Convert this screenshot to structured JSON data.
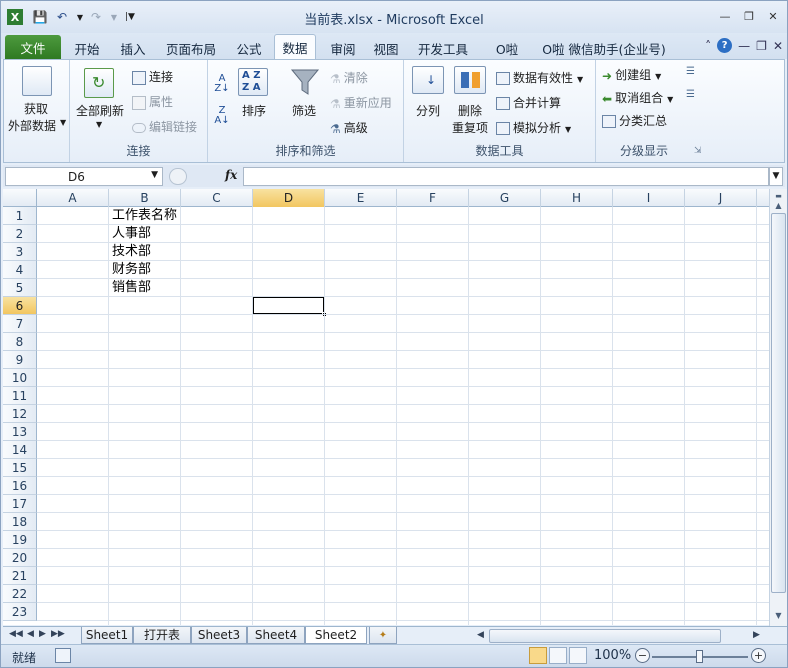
{
  "titlebar": {
    "title": "当前表.xlsx - Microsoft Excel"
  },
  "tabs": [
    {
      "label": "文件"
    },
    {
      "label": "开始"
    },
    {
      "label": "插入"
    },
    {
      "label": "页面布局"
    },
    {
      "label": "公式"
    },
    {
      "label": "数据"
    },
    {
      "label": "审阅"
    },
    {
      "label": "视图"
    },
    {
      "label": "开发工具"
    },
    {
      "label": "O啦"
    },
    {
      "label": "O啦 微信助手(企业号)"
    }
  ],
  "ribbon": {
    "get_external_data": {
      "line1": "获取",
      "line2": "外部数据"
    },
    "connections": {
      "refresh_all": "全部刷新",
      "connect": "连接",
      "properties": "属性",
      "edit_links": "编辑链接",
      "label": "连接"
    },
    "sort_filter": {
      "sort": "排序",
      "filter": "筛选",
      "clear": "清除",
      "reapply": "重新应用",
      "advanced": "高级",
      "label": "排序和筛选",
      "az": "A Z",
      "za": "Z A"
    },
    "data_tools": {
      "text_to_columns": "分列",
      "remove_dup_1": "删除",
      "remove_dup_2": "重复项",
      "validation": "数据有效性",
      "consolidate": "合并计算",
      "whatif": "模拟分析",
      "label": "数据工具"
    },
    "outline": {
      "group": "创建组",
      "ungroup": "取消组合",
      "subtotal": "分类汇总",
      "label": "分级显示"
    }
  },
  "formula_bar": {
    "name_box": "D6",
    "fx": "fx",
    "formula": ""
  },
  "columns": [
    "A",
    "B",
    "C",
    "D",
    "E",
    "F",
    "G",
    "H",
    "I",
    "J"
  ],
  "rows": [
    "1",
    "2",
    "3",
    "4",
    "5",
    "6",
    "7",
    "8",
    "9",
    "10",
    "11",
    "12",
    "13",
    "14",
    "15",
    "16",
    "17",
    "18",
    "19",
    "20",
    "21",
    "22",
    "23"
  ],
  "cells": {
    "B1": "工作表名称",
    "B2": "人事部",
    "B3": "技术部",
    "B4": "财务部",
    "B5": "销售部"
  },
  "selected_cell": "D6",
  "sheet_tabs": [
    "Sheet1",
    "打开表",
    "Sheet3",
    "Sheet4",
    "Sheet2"
  ],
  "active_sheet": "Sheet2",
  "status": {
    "ready": "就绪",
    "zoom": "100%"
  },
  "colors": {
    "file_tab": "#2f7a22",
    "selection_header": "#f2c660",
    "accent": "#1e3a5e"
  }
}
